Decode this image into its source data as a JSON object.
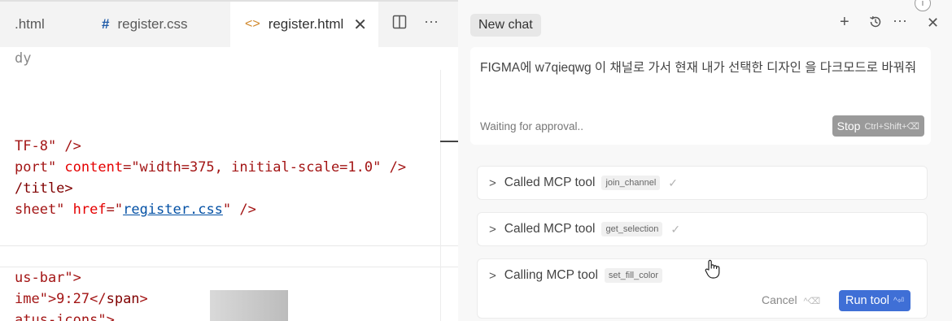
{
  "editor": {
    "tabs": {
      "tab1": ".html",
      "tab2_icon": "#",
      "tab2": "register.css",
      "tab3_icon": "<>",
      "tab3": "register.html",
      "close": "✕"
    },
    "code": {
      "l1": "dy",
      "l2_a": "TF-8\" />",
      "l3_a": "port\" ",
      "l3_attr": "content",
      "l3_b": "=\"width=375, initial-scale=1.0\" />",
      "l4": "/title>",
      "l5_a": "sheet\" ",
      "l5_attr": "href",
      "l5_b": "=\"",
      "l5_link": "register.css",
      "l5_c": "\" />",
      "l6": "us-bar\">",
      "l7_a": "ime\">9:27</",
      "l7_tag": "span",
      "l7_b": ">",
      "l8": "atus-icons\">"
    }
  },
  "chat": {
    "new_chat": "New chat",
    "prompt": "FIGMA에 w7qieqwg 이 채널로 가서 현재 내가 선택한 디자인 을 다크모드로 바꿔줘",
    "waiting": "Waiting for approval..",
    "stop_label": "Stop",
    "stop_kbd": "Ctrl+Shift+⌫",
    "tools": [
      {
        "label": "Called MCP tool",
        "name": "join_channel"
      },
      {
        "label": "Called MCP tool",
        "name": "get_selection"
      },
      {
        "label": "Calling MCP tool",
        "name": "set_fill_color"
      }
    ],
    "cancel_label": "Cancel",
    "cancel_kbd": "^⌫",
    "run_label": "Run tool",
    "run_kbd": "^⏎"
  },
  "colors": {
    "accent": "#3f6fd6",
    "css_hash": "#1e5aa8",
    "html_icon": "#d0872a"
  },
  "icons": [
    "split-editor-icon",
    "more-icon",
    "plus-icon",
    "history-icon",
    "close-icon",
    "info-icon",
    "chevron-right-icon",
    "check-icon",
    "hand-cursor-icon"
  ]
}
